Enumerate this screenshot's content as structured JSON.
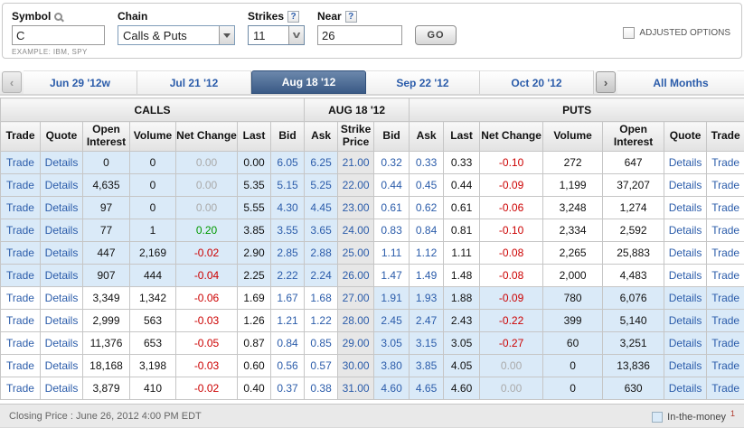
{
  "query_panel": {
    "symbol_label": "Symbol",
    "symbol_value": "C",
    "symbol_example": "EXAMPLE: IBM, SPY",
    "chain_label": "Chain",
    "chain_value": "Calls & Puts",
    "strikes_label": "Strikes",
    "strikes_value": "11",
    "near_label": "Near",
    "near_value": "26",
    "help_icon": "?",
    "go_label": "GO",
    "adjusted_label": "ADJUSTED OPTIONS"
  },
  "tabs": {
    "prev_icon": "‹",
    "next_icon": "›",
    "items": [
      {
        "label": "Jun 29 '12w",
        "active": false
      },
      {
        "label": "Jul 21 '12",
        "active": false
      },
      {
        "label": "Aug 18 '12",
        "active": true
      },
      {
        "label": "Sep 22 '12",
        "active": false
      },
      {
        "label": "Oct 20 '12",
        "active": false
      }
    ],
    "all_months_label": "All Months"
  },
  "table": {
    "group_headers": {
      "calls": "CALLS",
      "expiry": "AUG 18 '12",
      "puts": "PUTS"
    },
    "headers": {
      "trade": "Trade",
      "quote": "Quote",
      "open_interest": "Open Interest",
      "volume": "Volume",
      "net_change": "Net Change",
      "last": "Last",
      "bid": "Bid",
      "ask": "Ask",
      "strike_price": "Strike Price"
    },
    "trade_label": "Trade",
    "quote_label": "Details",
    "rows": [
      {
        "calls_itm": true,
        "puts_itm": false,
        "c_oi": "0",
        "c_vol": "0",
        "c_nc": "0.00",
        "c_last": "0.00",
        "c_bid": "6.05",
        "c_ask": "6.25",
        "strike": "21.00",
        "p_bid": "0.32",
        "p_ask": "0.33",
        "p_last": "0.33",
        "p_nc": "-0.10",
        "p_vol": "272",
        "p_oi": "647"
      },
      {
        "calls_itm": true,
        "puts_itm": false,
        "c_oi": "4,635",
        "c_vol": "0",
        "c_nc": "0.00",
        "c_last": "5.35",
        "c_bid": "5.15",
        "c_ask": "5.25",
        "strike": "22.00",
        "p_bid": "0.44",
        "p_ask": "0.45",
        "p_last": "0.44",
        "p_nc": "-0.09",
        "p_vol": "1,199",
        "p_oi": "37,207"
      },
      {
        "calls_itm": true,
        "puts_itm": false,
        "c_oi": "97",
        "c_vol": "0",
        "c_nc": "0.00",
        "c_last": "5.55",
        "c_bid": "4.30",
        "c_ask": "4.45",
        "strike": "23.00",
        "p_bid": "0.61",
        "p_ask": "0.62",
        "p_last": "0.61",
        "p_nc": "-0.06",
        "p_vol": "3,248",
        "p_oi": "1,274"
      },
      {
        "calls_itm": true,
        "puts_itm": false,
        "c_oi": "77",
        "c_vol": "1",
        "c_nc": "0.20",
        "c_last": "3.85",
        "c_bid": "3.55",
        "c_ask": "3.65",
        "strike": "24.00",
        "p_bid": "0.83",
        "p_ask": "0.84",
        "p_last": "0.81",
        "p_nc": "-0.10",
        "p_vol": "2,334",
        "p_oi": "2,592"
      },
      {
        "calls_itm": true,
        "puts_itm": false,
        "c_oi": "447",
        "c_vol": "2,169",
        "c_nc": "-0.02",
        "c_last": "2.90",
        "c_bid": "2.85",
        "c_ask": "2.88",
        "strike": "25.00",
        "p_bid": "1.11",
        "p_ask": "1.12",
        "p_last": "1.11",
        "p_nc": "-0.08",
        "p_vol": "2,265",
        "p_oi": "25,883"
      },
      {
        "calls_itm": true,
        "puts_itm": false,
        "c_oi": "907",
        "c_vol": "444",
        "c_nc": "-0.04",
        "c_last": "2.25",
        "c_bid": "2.22",
        "c_ask": "2.24",
        "strike": "26.00",
        "p_bid": "1.47",
        "p_ask": "1.49",
        "p_last": "1.48",
        "p_nc": "-0.08",
        "p_vol": "2,000",
        "p_oi": "4,483"
      },
      {
        "calls_itm": false,
        "puts_itm": true,
        "c_oi": "3,349",
        "c_vol": "1,342",
        "c_nc": "-0.06",
        "c_last": "1.69",
        "c_bid": "1.67",
        "c_ask": "1.68",
        "strike": "27.00",
        "p_bid": "1.91",
        "p_ask": "1.93",
        "p_last": "1.88",
        "p_nc": "-0.09",
        "p_vol": "780",
        "p_oi": "6,076"
      },
      {
        "calls_itm": false,
        "puts_itm": true,
        "c_oi": "2,999",
        "c_vol": "563",
        "c_nc": "-0.03",
        "c_last": "1.26",
        "c_bid": "1.21",
        "c_ask": "1.22",
        "strike": "28.00",
        "p_bid": "2.45",
        "p_ask": "2.47",
        "p_last": "2.43",
        "p_nc": "-0.22",
        "p_vol": "399",
        "p_oi": "5,140"
      },
      {
        "calls_itm": false,
        "puts_itm": true,
        "c_oi": "11,376",
        "c_vol": "653",
        "c_nc": "-0.05",
        "c_last": "0.87",
        "c_bid": "0.84",
        "c_ask": "0.85",
        "strike": "29.00",
        "p_bid": "3.05",
        "p_ask": "3.15",
        "p_last": "3.05",
        "p_nc": "-0.27",
        "p_vol": "60",
        "p_oi": "3,251"
      },
      {
        "calls_itm": false,
        "puts_itm": true,
        "c_oi": "18,168",
        "c_vol": "3,198",
        "c_nc": "-0.03",
        "c_last": "0.60",
        "c_bid": "0.56",
        "c_ask": "0.57",
        "strike": "30.00",
        "p_bid": "3.80",
        "p_ask": "3.85",
        "p_last": "4.05",
        "p_nc": "0.00",
        "p_vol": "0",
        "p_oi": "13,836"
      },
      {
        "calls_itm": false,
        "puts_itm": true,
        "c_oi": "3,879",
        "c_vol": "410",
        "c_nc": "-0.02",
        "c_last": "0.40",
        "c_bid": "0.37",
        "c_ask": "0.38",
        "strike": "31.00",
        "p_bid": "4.60",
        "p_ask": "4.65",
        "p_last": "4.60",
        "p_nc": "0.00",
        "p_vol": "0",
        "p_oi": "630"
      }
    ]
  },
  "footer": {
    "closing_price": "Closing Price : June 26, 2012 4:00 PM EDT",
    "itm_label": "In-the-money",
    "itm_sup": "1"
  },
  "colors": {
    "itm_highlight": "#daeaf8",
    "active_tab": "#3a5a86",
    "link": "#2b5caa",
    "negative": "#cc0000",
    "positive": "#009900",
    "neutral": "#aaaaaa"
  }
}
